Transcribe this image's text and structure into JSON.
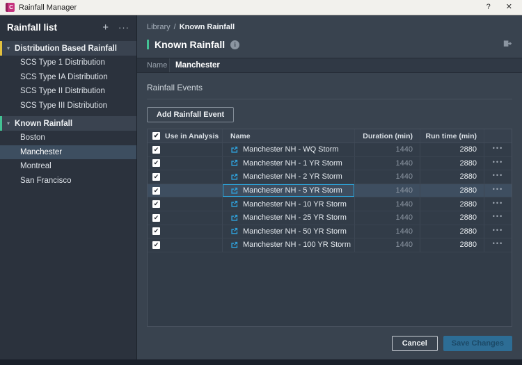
{
  "window": {
    "title": "Rainfall Manager",
    "app_icon_letter": "C"
  },
  "icons": {
    "help": "?",
    "close": "✕",
    "plus": "+",
    "more": "···",
    "caret_down": "▾",
    "info": "i",
    "check": "✔",
    "ellipsis": "•••",
    "breadcrumb_separator": "/"
  },
  "sidebar": {
    "title": "Rainfall list",
    "groups": [
      {
        "label": "Distribution Based Rainfall",
        "color": "#e3c13e",
        "items": [
          "SCS Type 1 Distribution",
          "SCS Type IA Distribution",
          "SCS Type II Distribution",
          "SCS Type III Distribution"
        ]
      },
      {
        "label": "Known Rainfall",
        "color": "#43c294",
        "selected": "Manchester",
        "items": [
          "Boston",
          "Manchester",
          "Montreal",
          "San Francisco"
        ]
      }
    ]
  },
  "breadcrumb": {
    "parent": "Library",
    "current": "Known Rainfall"
  },
  "page": {
    "title": "Known Rainfall"
  },
  "name_field": {
    "label": "Name",
    "value": "Manchester"
  },
  "events_section": {
    "title": "Rainfall Events",
    "add_button": "Add Rainfall Event"
  },
  "table": {
    "headers": {
      "use": "Use in Analysis",
      "name": "Name",
      "duration": "Duration (min)",
      "runtime": "Run time (min)"
    },
    "rows": [
      {
        "checked": true,
        "name": "Manchester NH - WQ Storm",
        "duration": "1440",
        "runtime": "2880",
        "selected": false
      },
      {
        "checked": true,
        "name": "Manchester NH - 1 YR Storm",
        "duration": "1440",
        "runtime": "2880",
        "selected": false
      },
      {
        "checked": true,
        "name": "Manchester NH - 2 YR Storm",
        "duration": "1440",
        "runtime": "2880",
        "selected": false
      },
      {
        "checked": true,
        "name": "Manchester NH - 5 YR Storm",
        "duration": "1440",
        "runtime": "2880",
        "selected": true
      },
      {
        "checked": true,
        "name": "Manchester NH - 10 YR Storm",
        "duration": "1440",
        "runtime": "2880",
        "selected": false
      },
      {
        "checked": true,
        "name": "Manchester NH - 25 YR Storm",
        "duration": "1440",
        "runtime": "2880",
        "selected": false
      },
      {
        "checked": true,
        "name": "Manchester NH - 50 YR Storm",
        "duration": "1440",
        "runtime": "2880",
        "selected": false
      },
      {
        "checked": true,
        "name": "Manchester NH - 100 YR Storm",
        "duration": "1440",
        "runtime": "2880",
        "selected": false
      }
    ]
  },
  "footer": {
    "cancel": "Cancel",
    "save": "Save Changes"
  },
  "colors": {
    "accent_blue": "#2f9fd8",
    "focus_border": "#2ba7df",
    "group_yellow": "#e3c13e",
    "group_green": "#43c294",
    "selection": "#3d4e60",
    "save_button": "#2d6d95"
  }
}
